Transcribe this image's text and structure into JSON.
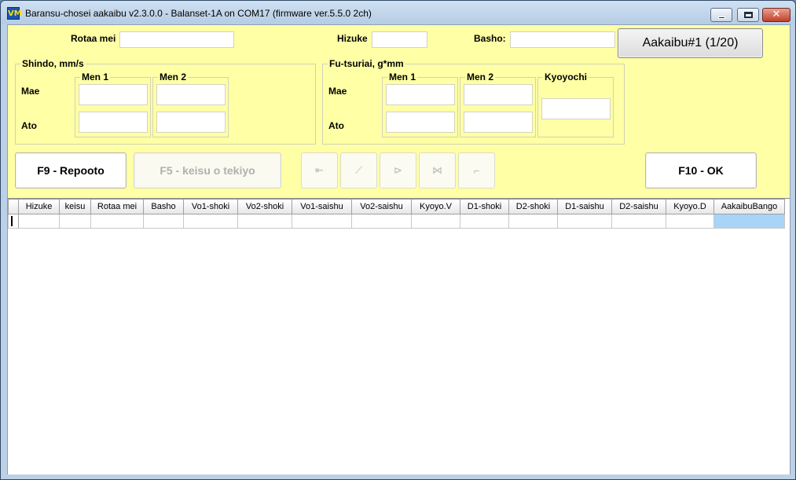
{
  "window": {
    "icon_text": "VM",
    "title": "Baransu-chosei aakaibu v2.3.0.0 - Balanset-1A on COM17 (firmware ver.5.5.0 2ch)",
    "minimize_glyph": "",
    "maximize_glyph": "",
    "close_glyph": "✕"
  },
  "header": {
    "rotor_label": "Rotaa mei",
    "rotor_value": "",
    "date_label": "Hizuke",
    "date_value": "",
    "place_label": "Basho:",
    "place_value": "",
    "archive_button": "Aakaibu#1 (1/20)"
  },
  "vibration": {
    "title": "Shindo, mm/s",
    "plane1": "Men 1",
    "plane2": "Men 2",
    "before": "Mae",
    "after": "Ato",
    "values": {
      "p1_before": "",
      "p2_before": "",
      "p1_after": "",
      "p2_after": ""
    }
  },
  "unbalance": {
    "title": "Fu-tsuriai, g*mm",
    "plane1": "Men 1",
    "plane2": "Men 2",
    "tolerance": "Kyoyochi",
    "before": "Mae",
    "after": "Ato",
    "values": {
      "p1_before": "",
      "p2_before": "",
      "p1_after": "",
      "p2_after": "",
      "tolerance_value": ""
    }
  },
  "buttons": {
    "report": "F9 - Repooto",
    "apply_coeff": "F5 - keisu o tekiyo",
    "ok": "F10 - OK",
    "nav": [
      "⇤",
      "⟋",
      "⊳",
      "⋈",
      "⌐"
    ]
  },
  "table": {
    "columns": [
      "Hizuke",
      "keisu",
      "Rotaa mei",
      "Basho",
      "Vo1-shoki",
      "Vo2-shoki",
      "Vo1-saishu",
      "Vo2-saishu",
      "Kyoyo.V",
      "D1-shoki",
      "D2-shoki",
      "D1-saishu",
      "D2-saishu",
      "Kyoyo.D",
      "AakaibuBango"
    ],
    "rows": [
      [
        "",
        "",
        "",
        "",
        "",
        "",
        "",
        "",
        "",
        "",
        "",
        "",
        "",
        "",
        ""
      ]
    ]
  },
  "colors": {
    "panel_bg": "#ffffa6",
    "selected_cell": "#a8d4f8",
    "disabled_text": "#b0b0b0"
  }
}
